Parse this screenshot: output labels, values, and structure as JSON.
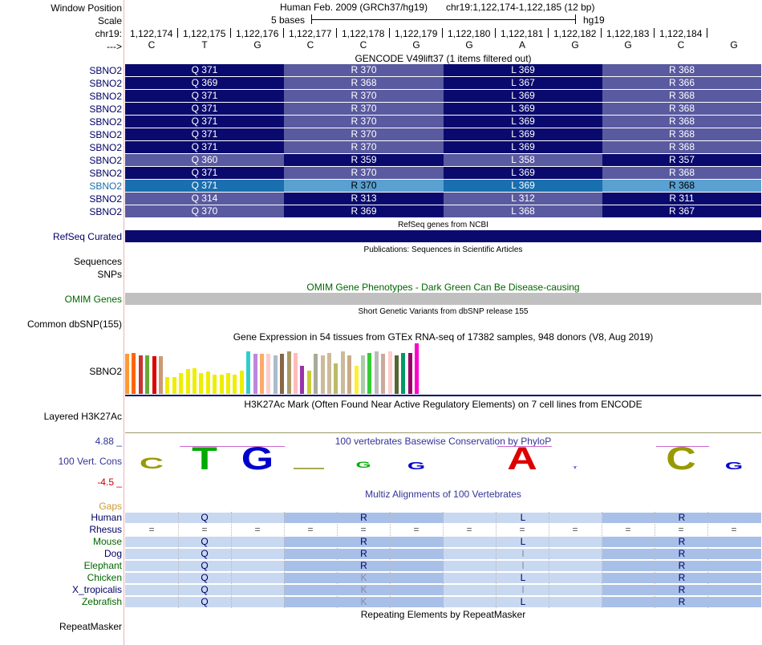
{
  "header": {
    "window_position_label": "Window Position",
    "scale_label": "Scale",
    "chrom_label": "chr19:",
    "strand_label": "--->",
    "assembly_title": "Human Feb. 2009 (GRCh37/hg19)",
    "region_text": "chr19:1,122,174-1,122,185 (12 bp)",
    "scale_text": "5 bases",
    "scale_db": "hg19",
    "positions": [
      "1,122,174",
      "1,122,175",
      "1,122,176",
      "1,122,177",
      "1,122,178",
      "1,122,179",
      "1,122,180",
      "1,122,181",
      "1,122,182",
      "1,122,183",
      "1,122,184"
    ],
    "bases": [
      "C",
      "T",
      "G",
      "C",
      "C",
      "G",
      "G",
      "A",
      "G",
      "G",
      "C",
      "G"
    ]
  },
  "gencode": {
    "title": "GENCODE V49lift37 (1 items filtered out)",
    "rows": [
      {
        "label": "SBNO2",
        "aa": [
          "Q 371",
          "R 370",
          "L 369",
          "R 368"
        ],
        "style": "a",
        "selected": false
      },
      {
        "label": "SBNO2",
        "aa": [
          "Q 369",
          "R 368",
          "L 367",
          "R 366"
        ],
        "style": "a",
        "selected": false
      },
      {
        "label": "SBNO2",
        "aa": [
          "Q 371",
          "R 370",
          "L 369",
          "R 368"
        ],
        "style": "a",
        "selected": false
      },
      {
        "label": "SBNO2",
        "aa": [
          "Q 371",
          "R 370",
          "L 369",
          "R 368"
        ],
        "style": "a",
        "selected": false
      },
      {
        "label": "SBNO2",
        "aa": [
          "Q 371",
          "R 370",
          "L 369",
          "R 368"
        ],
        "style": "a",
        "selected": false
      },
      {
        "label": "SBNO2",
        "aa": [
          "Q 371",
          "R 370",
          "L 369",
          "R 368"
        ],
        "style": "a",
        "selected": false
      },
      {
        "label": "SBNO2",
        "aa": [
          "Q 371",
          "R 370",
          "L 369",
          "R 368"
        ],
        "style": "a",
        "selected": false
      },
      {
        "label": "SBNO2",
        "aa": [
          "Q 360",
          "R 359",
          "L 358",
          "R 357"
        ],
        "style": "b",
        "selected": false
      },
      {
        "label": "SBNO2",
        "aa": [
          "Q 371",
          "R 370",
          "L 369",
          "R 368"
        ],
        "style": "a",
        "selected": false
      },
      {
        "label": "SBNO2",
        "aa": [
          "Q 371",
          "R 370",
          "L 369",
          "R 368"
        ],
        "style": "a",
        "selected": true
      },
      {
        "label": "SBNO2",
        "aa": [
          "Q 314",
          "R 313",
          "L 312",
          "R 311"
        ],
        "style": "b",
        "selected": false
      },
      {
        "label": "SBNO2",
        "aa": [
          "Q 370",
          "R 369",
          "L 368",
          "R 367"
        ],
        "style": "b",
        "selected": false
      }
    ]
  },
  "refseq": {
    "title": "RefSeq genes from NCBI",
    "label": "RefSeq Curated"
  },
  "publications": {
    "title": "Publications: Sequences in Scientific Articles",
    "label1": "Sequences",
    "label2": "SNPs"
  },
  "omim": {
    "title": "OMIM Gene Phenotypes - Dark Green Can Be Disease-causing",
    "label": "OMIM Genes"
  },
  "dbsnp": {
    "title": "Short Genetic Variants from dbSNP release 155",
    "label": "Common dbSNP(155)"
  },
  "gtex": {
    "title": "Gene Expression in 54 tissues from GTEx RNA-seq of 17382 samples, 948 donors (V8, Aug 2019)",
    "label": "SBNO2",
    "bars": [
      {
        "c": "#ff9933",
        "v": 0.78
      },
      {
        "c": "#ff6600",
        "v": 0.8
      },
      {
        "c": "#cc3333",
        "v": 0.75
      },
      {
        "c": "#66aa33",
        "v": 0.75
      },
      {
        "c": "#dd0000",
        "v": 0.73
      },
      {
        "c": "#cc9977",
        "v": 0.73
      },
      {
        "c": "#eeee00",
        "v": 0.33
      },
      {
        "c": "#eeee00",
        "v": 0.33
      },
      {
        "c": "#eeee00",
        "v": 0.4
      },
      {
        "c": "#eeee00",
        "v": 0.48
      },
      {
        "c": "#eeee00",
        "v": 0.5
      },
      {
        "c": "#eeee00",
        "v": 0.4
      },
      {
        "c": "#eeee00",
        "v": 0.43
      },
      {
        "c": "#eeee00",
        "v": 0.38
      },
      {
        "c": "#eeee00",
        "v": 0.38
      },
      {
        "c": "#eeee00",
        "v": 0.4
      },
      {
        "c": "#eeee00",
        "v": 0.38
      },
      {
        "c": "#eeee00",
        "v": 0.46
      },
      {
        "c": "#33cccc",
        "v": 0.83
      },
      {
        "c": "#bb88dd",
        "v": 0.78
      },
      {
        "c": "#ffaa66",
        "v": 0.78
      },
      {
        "c": "#ffcccc",
        "v": 0.78
      },
      {
        "c": "#aabbcc",
        "v": 0.75
      },
      {
        "c": "#886644",
        "v": 0.78
      },
      {
        "c": "#aa9966",
        "v": 0.83
      },
      {
        "c": "#ffbbbb",
        "v": 0.8
      },
      {
        "c": "#9933aa",
        "v": 0.55
      },
      {
        "c": "#cccc33",
        "v": 0.45
      },
      {
        "c": "#aaaa99",
        "v": 0.78
      },
      {
        "c": "#ccbb99",
        "v": 0.75
      },
      {
        "c": "#ccbb99",
        "v": 0.8
      },
      {
        "c": "#bbbb66",
        "v": 0.6
      },
      {
        "c": "#ccbb99",
        "v": 0.83
      },
      {
        "c": "#ccaa88",
        "v": 0.75
      },
      {
        "c": "#ffee33",
        "v": 0.55
      },
      {
        "c": "#aaccaa",
        "v": 0.75
      },
      {
        "c": "#33cc33",
        "v": 0.8
      },
      {
        "c": "#bbbbbb",
        "v": 0.83
      },
      {
        "c": "#ccaa99",
        "v": 0.78
      },
      {
        "c": "#ffcccc",
        "v": 0.83
      },
      {
        "c": "#556633",
        "v": 0.75
      },
      {
        "c": "#009966",
        "v": 0.8
      },
      {
        "c": "#990066",
        "v": 0.8
      },
      {
        "c": "#ff00cc",
        "v": 0.98
      }
    ]
  },
  "h3k27ac": {
    "title": "H3K27Ac Mark (Often Found Near Active Regulatory Elements) on 7 cell lines from ENCODE",
    "label": "Layered H3K27Ac"
  },
  "cons": {
    "title": "100 vertebrates Basewise Conservation by PhyloP",
    "label": "100 Vert. Cons",
    "ymax": "4.88 _",
    "ymin": "-4.5 _",
    "logos": [
      {
        "b": "C",
        "c": "#999900",
        "s": 0.45
      },
      {
        "b": "T",
        "c": "#00aa00",
        "s": 0.95
      },
      {
        "b": "G",
        "c": "#0000cc",
        "s": 0.95
      },
      {
        "b": "_",
        "c": "#aaaa55",
        "s": 0.08
      },
      {
        "b": "G",
        "c": "#00aa00",
        "s": 0.25
      },
      {
        "b": "G",
        "c": "#0000cc",
        "s": 0.28
      },
      {
        "b": "",
        "c": "#000000",
        "s": 0
      },
      {
        "b": "A",
        "c": "#dd0000",
        "s": 0.95
      },
      {
        "b": "T",
        "c": "#0000cc",
        "s": 0.1
      },
      {
        "b": "",
        "c": "#000000",
        "s": 0
      },
      {
        "b": "C",
        "c": "#999900",
        "s": 0.95
      },
      {
        "b": "G",
        "c": "#0000cc",
        "s": 0.28
      }
    ]
  },
  "multiz": {
    "title": "Multiz Alignments of 100 Vertebrates",
    "gaps_label": "Gaps",
    "species": [
      {
        "name": "Human",
        "color": "#000066",
        "aa": [
          "Q",
          "R",
          "L",
          "R"
        ]
      },
      {
        "name": "Rhesus",
        "color": "#000066",
        "eq": true
      },
      {
        "name": "Mouse",
        "color": "#006600",
        "aa": [
          "Q",
          "R",
          "L",
          "R"
        ]
      },
      {
        "name": "Dog",
        "color": "#000066",
        "aa": [
          "Q",
          "R",
          "I",
          "R"
        ]
      },
      {
        "name": "Elephant",
        "color": "#006600",
        "aa": [
          "Q",
          "R",
          "I",
          "R"
        ]
      },
      {
        "name": "Chicken",
        "color": "#006600",
        "aa": [
          "Q",
          "K",
          "L",
          "R"
        ]
      },
      {
        "name": "X_tropicalis",
        "color": "#000066",
        "aa": [
          "Q",
          "K",
          "I",
          "R"
        ]
      },
      {
        "name": "Zebrafish",
        "color": "#006600",
        "aa": [
          "Q",
          "K",
          "L",
          "R"
        ]
      }
    ]
  },
  "repeatmasker": {
    "title": "Repeating Elements by RepeatMasker",
    "label": "RepeatMasker"
  },
  "colors": {
    "dark_navy": "#0a0a6e",
    "mid_purple": "#5a5aa0",
    "selected_a": "#1a6fae",
    "selected_b": "#5aa0d0",
    "omim_gray": "#c0c0c0",
    "cons_pink": "#cc66cc"
  }
}
